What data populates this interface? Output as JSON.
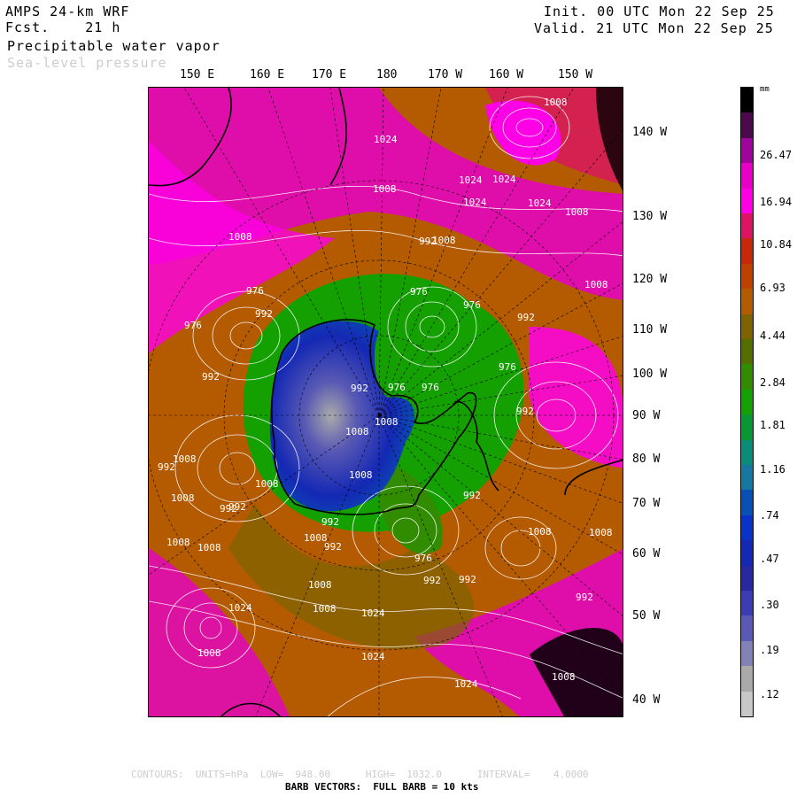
{
  "header": {
    "model": "AMPS 24-km WRF",
    "forecast": "Fcst.    21 h",
    "field_primary": "Precipitable water vapor",
    "field_secondary": "Sea-level pressure",
    "init": "Init. 00 UTC Mon 22 Sep 25",
    "valid": "Valid. 21 UTC Mon 22 Sep 25"
  },
  "longitude_top": [
    "150 E",
    "160 E",
    "170 E",
    "180",
    "170 W",
    "160 W",
    "150 W"
  ],
  "longitude_right": [
    "140 W",
    "130 W",
    "120 W",
    "110 W",
    "100 W",
    "90 W",
    "80 W",
    "70 W",
    "60 W",
    "50 W",
    "40 W"
  ],
  "legend": {
    "units": "mm",
    "labels": [
      "26.47",
      "16.94",
      "10.84",
      "6.93",
      "4.44",
      "2.84",
      "1.81",
      "1.16",
      ".74",
      ".47",
      ".30",
      ".19",
      ".12"
    ],
    "colors": [
      "#000000",
      "#4b0a4b",
      "#a0059b",
      "#e600c8",
      "#ff00e6",
      "#dc1464",
      "#c8280a",
      "#be4100",
      "#b45a00",
      "#7d6400",
      "#556e00",
      "#328c00",
      "#14a000",
      "#0a9632",
      "#0a8c78",
      "#1478a0",
      "#0a50b4",
      "#0a32c8",
      "#1428b4",
      "#2828a0",
      "#3c3cb4",
      "#5a5ab4",
      "#8282b4",
      "#aaaaaa",
      "#c8c8c8"
    ]
  },
  "contour_labels": [
    "1008",
    "1024",
    "1008",
    "1024",
    "1024",
    "1008",
    "992",
    "1008",
    "1024",
    "1024",
    "1008",
    "1008",
    "976",
    "976",
    "992",
    "976",
    "992",
    "976",
    "992",
    "1008",
    "976",
    "976",
    "992",
    "976",
    "992",
    "992",
    "1008",
    "1008",
    "1008",
    "1008",
    "992",
    "992",
    "976",
    "992",
    "1008",
    "1008",
    "1024",
    "1024",
    "1008",
    "1024",
    "1008",
    "1008",
    "992",
    "992",
    "992",
    "1008",
    "1024",
    "1008",
    "992",
    "1008",
    "1008",
    "992",
    "1008"
  ],
  "footer": {
    "contours": "CONTOURS:  UNITS=hPa  LOW=  948.00      HIGH=  1032.0      INTERVAL=    4.0000",
    "barbs": "BARB VECTORS:  FULL BARB = 10 kts"
  },
  "colors": {
    "coast": "#000000",
    "isobar": "#ffffff",
    "grid": "#000000",
    "secondary_text": "#cccccc"
  }
}
